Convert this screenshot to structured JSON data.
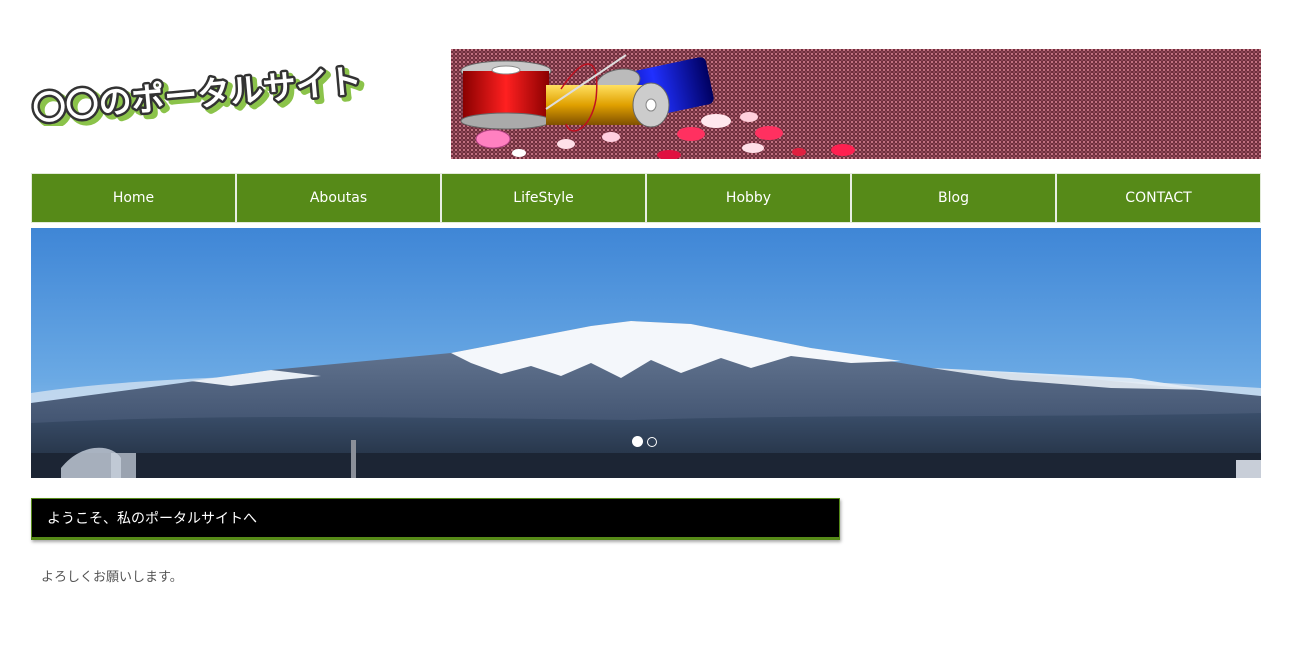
{
  "site": {
    "logo_text": "〇〇のポータルサイト"
  },
  "nav": {
    "items": [
      {
        "label": "Home"
      },
      {
        "label": "Aboutas"
      },
      {
        "label": "LifeStyle"
      },
      {
        "label": "Hobby"
      },
      {
        "label": "Blog"
      },
      {
        "label": "CONTACT"
      }
    ]
  },
  "slider": {
    "slide_count": 2,
    "active_index": 0
  },
  "main": {
    "welcome_heading": "ようこそ、私のポータルサイトへ",
    "body_text": "よろしくお願いします。"
  },
  "colors": {
    "nav_green": "#568a18",
    "heading_bg": "#000000",
    "body_text": "#555555"
  }
}
